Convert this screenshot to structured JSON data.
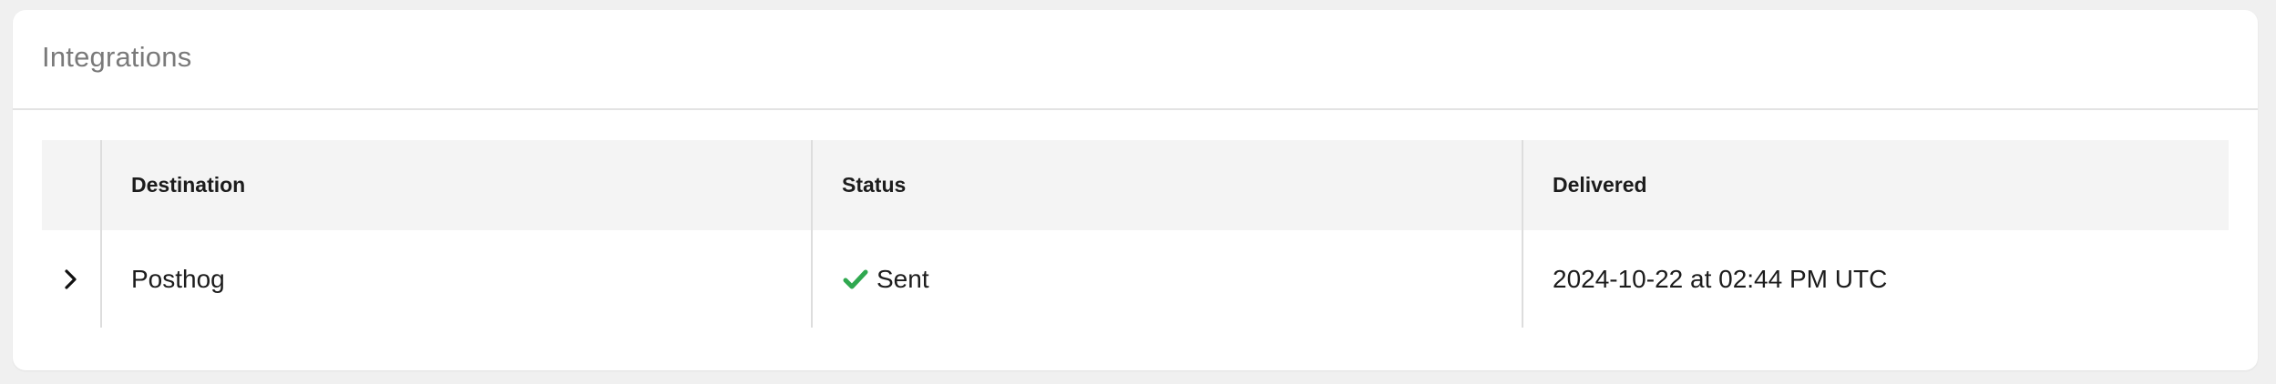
{
  "panel": {
    "title": "Integrations"
  },
  "table": {
    "columns": [
      {
        "label": "Destination"
      },
      {
        "label": "Status"
      },
      {
        "label": "Delivered"
      }
    ],
    "rows": [
      {
        "destination": "Posthog",
        "status": "Sent",
        "status_icon": "check-icon",
        "delivered": "2024-10-22 at 02:44 PM UTC"
      }
    ]
  },
  "colors": {
    "success": "#2fa84f",
    "header_bg": "#f4f4f4",
    "title": "#7a7a7a"
  }
}
